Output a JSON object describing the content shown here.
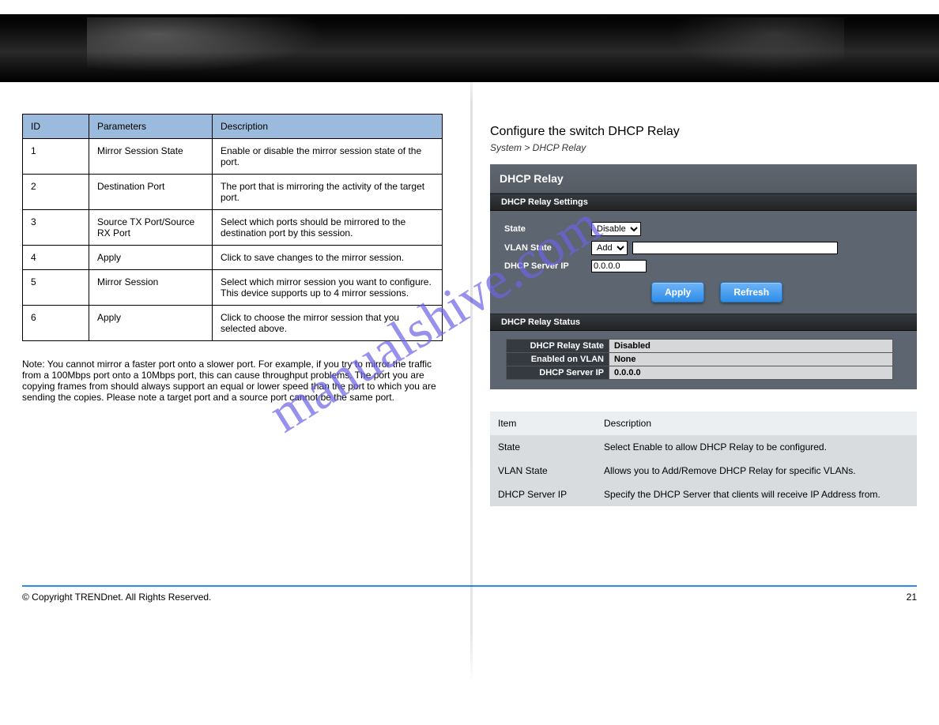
{
  "watermark": "manualshive.com",
  "left": {
    "headers": [
      "ID",
      "Parameters",
      "Description"
    ],
    "rows": [
      {
        "id": "1",
        "param": "Mirror Session State",
        "desc": "Enable or disable the mirror session state of the port."
      },
      {
        "id": "2",
        "param": "Destination Port",
        "desc": "The port that is mirroring the activity of the target port."
      },
      {
        "id": "3",
        "param": "Source TX Port/Source RX Port",
        "desc": "Select which ports should be mirrored to the destination port by this session."
      },
      {
        "id": "4",
        "param": "Apply",
        "desc": "Click to save changes to the mirror session."
      },
      {
        "id": "5",
        "param": "Mirror Session",
        "desc": "Select which mirror session you want to configure. This device supports up to 4 mirror sessions."
      },
      {
        "id": "6",
        "param": "Apply",
        "desc": "Click to choose the mirror session that you selected above."
      }
    ],
    "note": "Note: You cannot mirror a faster port onto a slower port. For example, if you try to mirror the traffic from a 100Mbps port onto a 10Mbps port, this can cause throughput problems. The port you are copying frames from should always support an equal or lower speed than the port to which you are sending the copies. Please note a target port and a source port cannot be the same port."
  },
  "right": {
    "heading_title": "Configure the switch DHCP Relay",
    "path": "System > DHCP Relay",
    "panel": {
      "title": "DHCP Relay",
      "settings_label": "DHCP Relay Settings",
      "state_label": "State",
      "state_value": "Disable",
      "vlan_state_label": "VLAN State",
      "vlan_state_value": "Add",
      "vlan_text_value": "",
      "server_ip_label": "DHCP Server IP",
      "server_ip_value": "0.0.0.0",
      "apply_label": "Apply",
      "refresh_label": "Refresh",
      "status_label": "DHCP Relay Status",
      "status_rows": [
        {
          "k": "DHCP Relay State",
          "v": "Disabled"
        },
        {
          "k": "Enabled on VLAN",
          "v": "None"
        },
        {
          "k": "DHCP Server IP",
          "v": "0.0.0.0"
        }
      ]
    },
    "desc_table": {
      "headers": [
        "Item",
        "Description"
      ],
      "rows": [
        {
          "item": "State",
          "desc": "Select Enable to allow DHCP Relay to be configured."
        },
        {
          "item": "VLAN State",
          "desc": "Allows you to Add/Remove DHCP Relay for specific VLANs."
        },
        {
          "item": "DHCP Server IP",
          "desc": "Specify the DHCP Server that clients will receive IP Address from."
        }
      ]
    }
  },
  "footer": {
    "copyright": "© Copyright TRENDnet. All Rights Reserved.",
    "page": "21"
  }
}
